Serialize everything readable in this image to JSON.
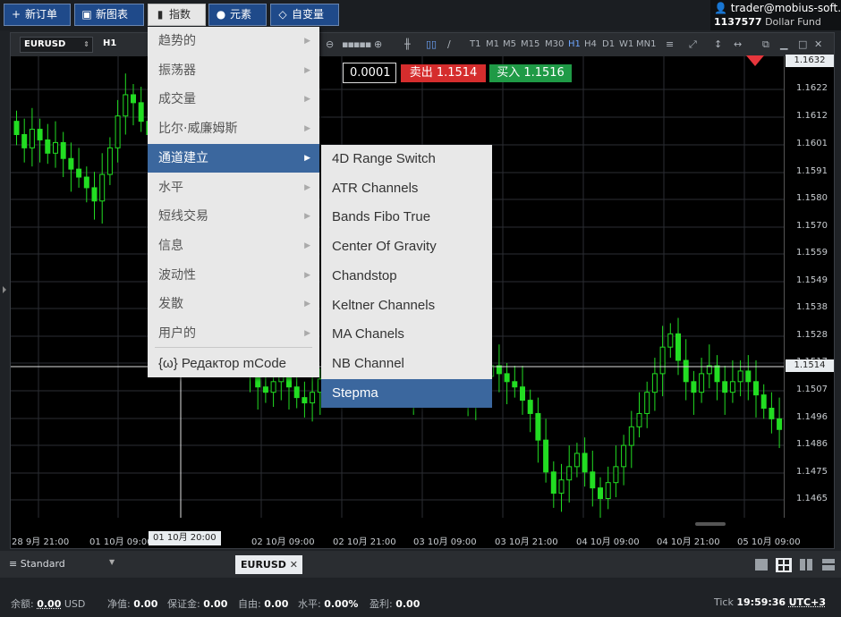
{
  "toolbar": {
    "new_order": "新订单",
    "new_chart": "新图表",
    "indicators": "指数",
    "elements": "元素",
    "variables": "自变量"
  },
  "account": {
    "email": "trader@mobius-soft.org",
    "number": "1137577",
    "fund": "Dollar Fund"
  },
  "chart": {
    "symbol": "EURUSD",
    "timeframe": "H1",
    "timeframes": [
      "T1",
      "M1",
      "M5",
      "M15",
      "M30",
      "H1",
      "H4",
      "D1",
      "W1",
      "MN1"
    ],
    "selected_timeframe": "H1",
    "lot": "0.0001",
    "sell": "卖出 1.1514",
    "buy": "买入 1.1516",
    "price_ticks": [
      "1.1622",
      "1.1612",
      "1.1601",
      "1.1591",
      "1.1580",
      "1.1570",
      "1.1559",
      "1.1549",
      "1.1538",
      "1.1528",
      "1.1517",
      "1.1507",
      "1.1496",
      "1.1486",
      "1.1475",
      "1.1465"
    ],
    "price_top_tag": "1.1632",
    "price_current_tag": "1.1514",
    "time_ticks": [
      "28 9月 21:00",
      "01 10月 09:00",
      "01 10月 20:00",
      "02 10月 09:00",
      "02 10月 21:00",
      "03 10月 09:00",
      "03 10月 21:00",
      "04 10月 09:00",
      "04 10月 21:00",
      "05 10月 09:00"
    ],
    "time_cursor_tag": "01 10月 20:00",
    "colors": {
      "up": "#22dd22",
      "down": "#22dd22",
      "grid": "#2b2e33",
      "crosshair": "#e0e0e0"
    }
  },
  "indicator_menu": {
    "items": [
      "趋势的",
      "振荡器",
      "成交量",
      "比尔·威廉姆斯",
      "通道建立",
      "水平",
      "短线交易",
      "信息",
      "波动性",
      "发散",
      "用户的"
    ],
    "selected": "通道建立",
    "editor": "Редактор mCode"
  },
  "channel_submenu": {
    "items": [
      "4D Range Switch",
      "ATR Channels",
      "Bands Fibo True",
      "Center Of Gravity",
      "Chandstop",
      "Keltner Channels",
      "MA Chanels",
      "NB Channel",
      "Stepma"
    ],
    "selected": "Stepma"
  },
  "tabs": {
    "layout": "Standard",
    "active_tab": "EURUSD"
  },
  "status": {
    "balance_label": "余额:",
    "balance_value": "0.00",
    "currency": "USD",
    "equity_label": "净值:",
    "equity_value": "0.00",
    "margin_label": "保证金:",
    "margin_value": "0.00",
    "free_label": "自由:",
    "free_value": "0.00",
    "level_label": "水平:",
    "level_value": "0.00%",
    "profit_label": "盈利:",
    "profit_value": "0.00",
    "tick_label": "Tick",
    "time": "19:59:36",
    "tz": "UTC+3"
  }
}
